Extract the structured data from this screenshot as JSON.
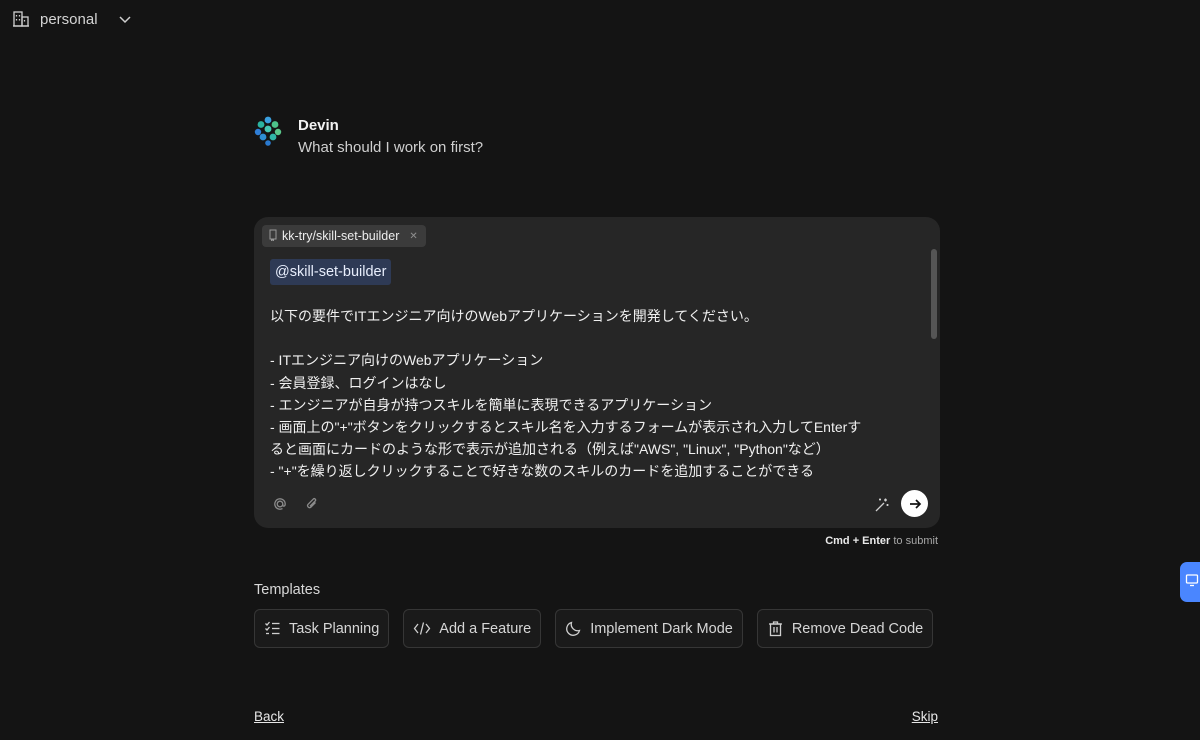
{
  "topbar": {
    "workspace": "personal"
  },
  "intro": {
    "agent_name": "Devin",
    "question": "What should I work on first?"
  },
  "composer": {
    "repo_chip": "kk-try/skill-set-builder",
    "mention": "@skill-set-builder",
    "lines": [
      "以下の要件でITエンジニア向けのWebアプリケーションを開発してください。",
      "",
      " - ITエンジニア向けのWebアプリケーション",
      " - 会員登録、ログインはなし",
      " - エンジニアが自身が持つスキルを簡単に表現できるアプリケーション",
      " - 画面上の\"+\"ボタンをクリックするとスキル名を入力するフォームが表示され入力してEnterす",
      "ると画面にカードのような形で表示が追加される（例えば\"AWS\", \"Linux\", \"Python\"など）",
      " - \"+\"を繰り返しクリックすることで好きな数のスキルのカードを追加することができる"
    ]
  },
  "hint": {
    "keys": "Cmd + Enter",
    "suffix": " to submit"
  },
  "templates": {
    "title": "Templates",
    "items": [
      {
        "label": "Task Planning",
        "icon": "checklist-icon"
      },
      {
        "label": "Add a Feature",
        "icon": "code-icon"
      },
      {
        "label": "Implement Dark Mode",
        "icon": "moon-icon"
      },
      {
        "label": "Remove Dead Code",
        "icon": "trash-icon"
      }
    ]
  },
  "nav": {
    "back": "Back",
    "skip": "Skip"
  },
  "colors": {
    "background": "#141414",
    "composer": "#262626",
    "accent": "#4a86ff",
    "mention_bg": "#2e3a55"
  }
}
